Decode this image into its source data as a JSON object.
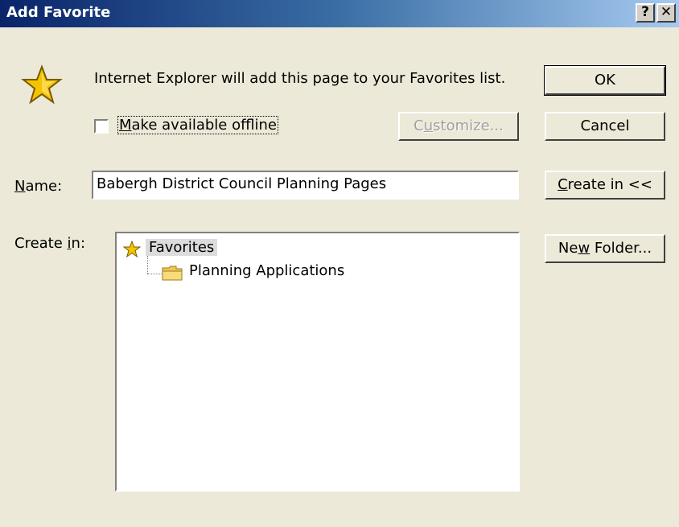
{
  "window": {
    "title": "Add Favorite",
    "help_glyph": "?",
    "close_glyph": "✕"
  },
  "message": "Internet Explorer will add this page to your Favorites list.",
  "offline": {
    "label_prefix": "",
    "label_hotkey": "M",
    "label_rest": "ake available offline",
    "checked": false
  },
  "buttons": {
    "ok": "OK",
    "cancel": "Cancel",
    "customize_pre": "C",
    "customize_hot": "u",
    "customize_post": "stomize...",
    "create_in_hot": "C",
    "create_in_post": "reate in <<",
    "new_folder_pre": "Ne",
    "new_folder_hot": "w",
    "new_folder_post": " Folder..."
  },
  "name_field": {
    "label_hot": "N",
    "label_rest": "ame:",
    "value": "Babergh District Council Planning Pages"
  },
  "create_in": {
    "label_pre": "Create ",
    "label_hot": "i",
    "label_post": "n:"
  },
  "tree": {
    "root": {
      "label": "Favorites",
      "icon": "star-icon"
    },
    "children": [
      {
        "label": "Planning Applications",
        "icon": "folder-icon"
      }
    ]
  },
  "colors": {
    "dialog_bg": "#ece9d8",
    "title_start": "#0a246a",
    "title_end": "#a6caf0",
    "star_fill": "#f5c400"
  }
}
